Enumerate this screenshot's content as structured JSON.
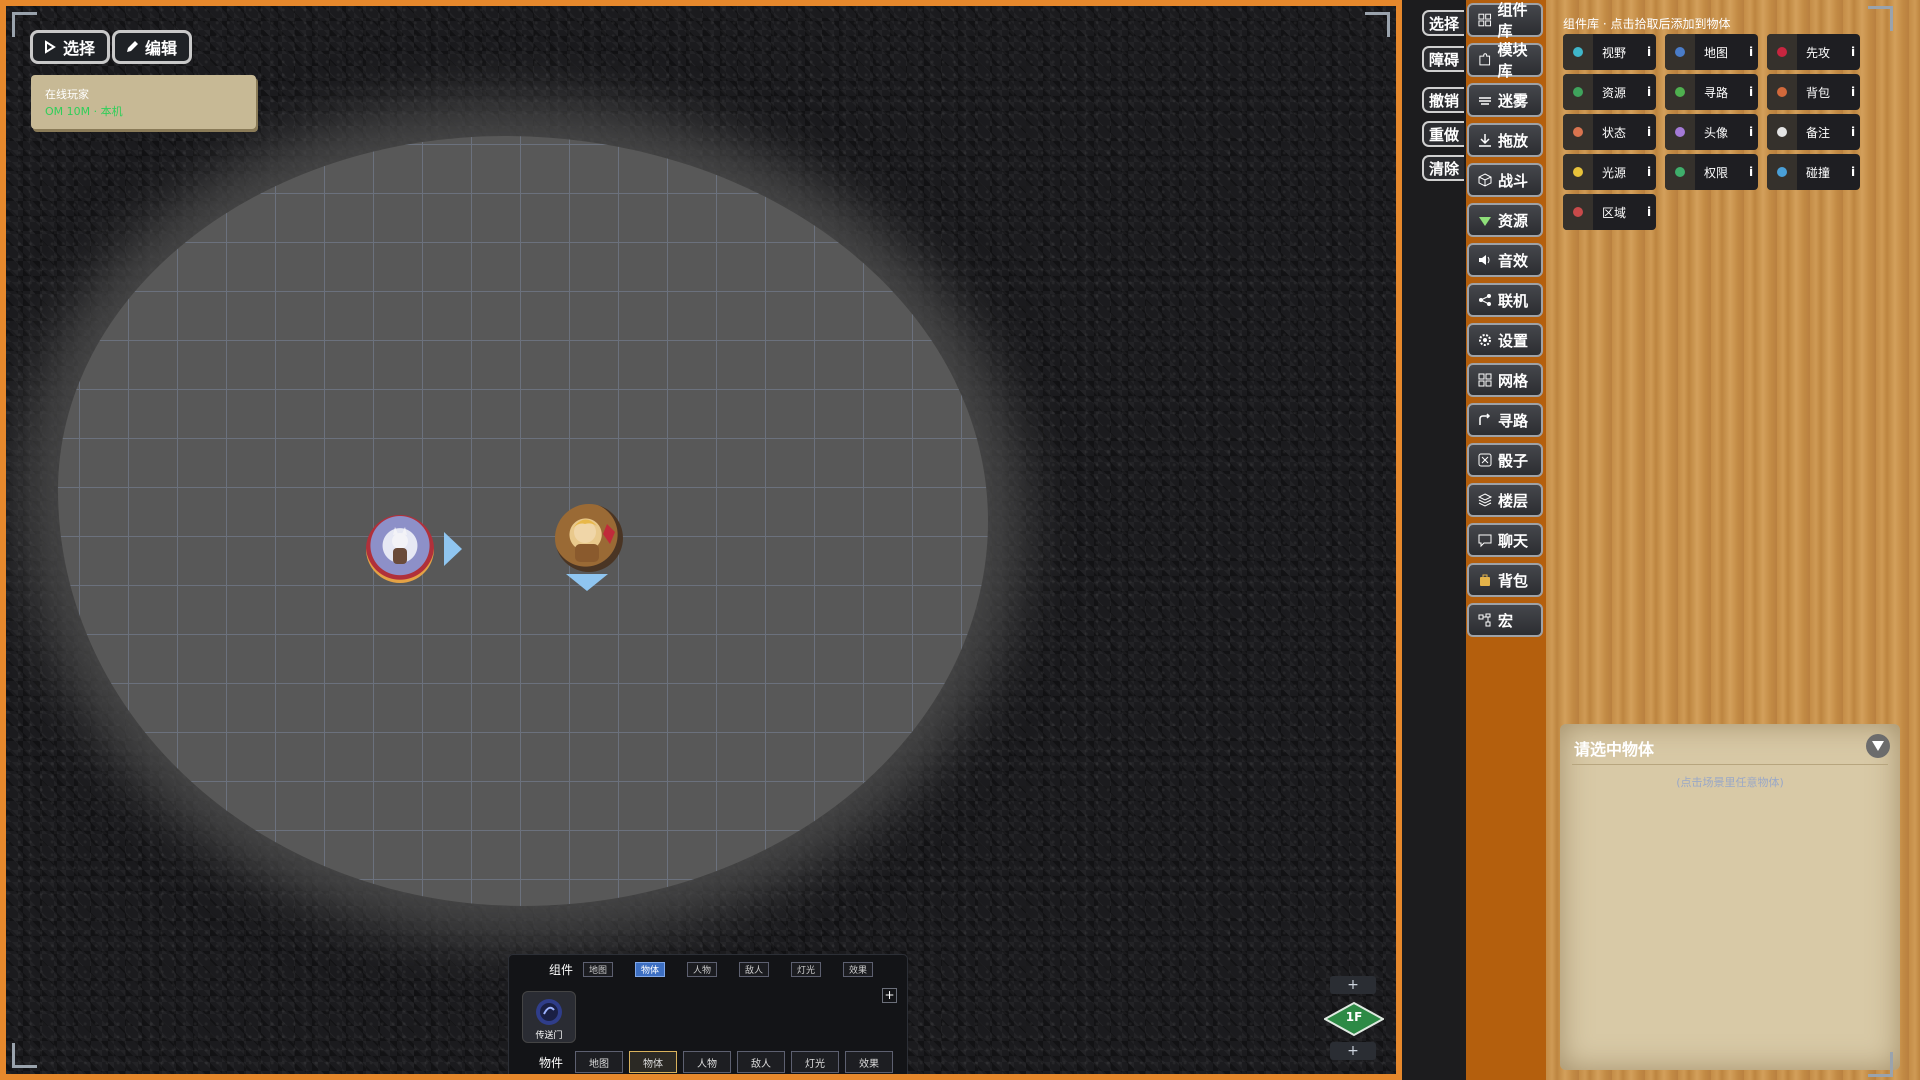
{
  "toolbar": {
    "select": "选择",
    "edit": "编辑"
  },
  "online": {
    "title": "在线玩家",
    "status": "OM 10M · 本机"
  },
  "bottom_panel": {
    "components_label": "组件",
    "top_tabs": [
      "地图",
      "物体",
      "人物",
      "敌人",
      "灯光",
      "效果"
    ],
    "top_selected": "物体",
    "portal_label": "传送门",
    "objects_label": "物件",
    "bottom_tabs": [
      "地图",
      "物体",
      "人物",
      "敌人",
      "灯光",
      "效果"
    ],
    "bottom_selected": "物体",
    "add": "+"
  },
  "floor": {
    "label": "1F",
    "plus": "+"
  },
  "middle_buttons": [
    "选择",
    "障碍",
    "撤销",
    "重做",
    "清除"
  ],
  "tools": [
    {
      "label": "组件库",
      "icon": "grid-icon"
    },
    {
      "label": "模块库",
      "icon": "puzzle-icon"
    },
    {
      "label": "迷雾",
      "icon": "fog-icon"
    },
    {
      "label": "拖放",
      "icon": "download-icon"
    },
    {
      "label": "战斗",
      "icon": "cube-icon"
    },
    {
      "label": "资源",
      "icon": "gem-icon"
    },
    {
      "label": "音效",
      "icon": "speaker-icon"
    },
    {
      "label": "联机",
      "icon": "share-icon"
    },
    {
      "label": "设置",
      "icon": "gear-icon"
    },
    {
      "label": "网格",
      "icon": "grid-icon"
    },
    {
      "label": "寻路",
      "icon": "route-icon"
    },
    {
      "label": "骰子",
      "icon": "dice-icon"
    },
    {
      "label": "楼层",
      "icon": "layers-icon"
    },
    {
      "label": "聊天",
      "icon": "chat-icon"
    },
    {
      "label": "背包",
      "icon": "bag-icon"
    },
    {
      "label": "宏",
      "icon": "macro-icon"
    }
  ],
  "components": {
    "header": "组件库 · 点击拾取后添加到物体",
    "items": [
      {
        "label": "视野",
        "icon": "eye-icon",
        "color": "#3fb6c9"
      },
      {
        "label": "地图",
        "icon": "map-icon",
        "color": "#4a7cc8"
      },
      {
        "label": "先攻",
        "icon": "cube-icon",
        "color": "#c8253f"
      },
      {
        "label": "资源",
        "icon": "box-icon",
        "color": "#3fa35c"
      },
      {
        "label": "寻路",
        "icon": "target-icon",
        "color": "#4fb04f"
      },
      {
        "label": "背包",
        "icon": "bag-icon",
        "color": "#d2693b"
      },
      {
        "label": "状态",
        "icon": "heart-icon",
        "color": "#d9744f"
      },
      {
        "label": "头像",
        "icon": "person-icon",
        "color": "#a47ad6"
      },
      {
        "label": "备注",
        "icon": "note-icon",
        "color": "#e4e4e4"
      },
      {
        "label": "光源",
        "icon": "sun-icon",
        "color": "#e8c23a"
      },
      {
        "label": "权限",
        "icon": "people-icon",
        "color": "#3fae6b"
      },
      {
        "label": "碰撞",
        "icon": "shield-icon",
        "color": "#4aa0d8"
      },
      {
        "label": "区域",
        "icon": "area-icon",
        "color": "#c84a4a"
      }
    ],
    "info": "i"
  },
  "inspector": {
    "title": "请选中物体",
    "hint": "(点击场景里任意物体)"
  }
}
